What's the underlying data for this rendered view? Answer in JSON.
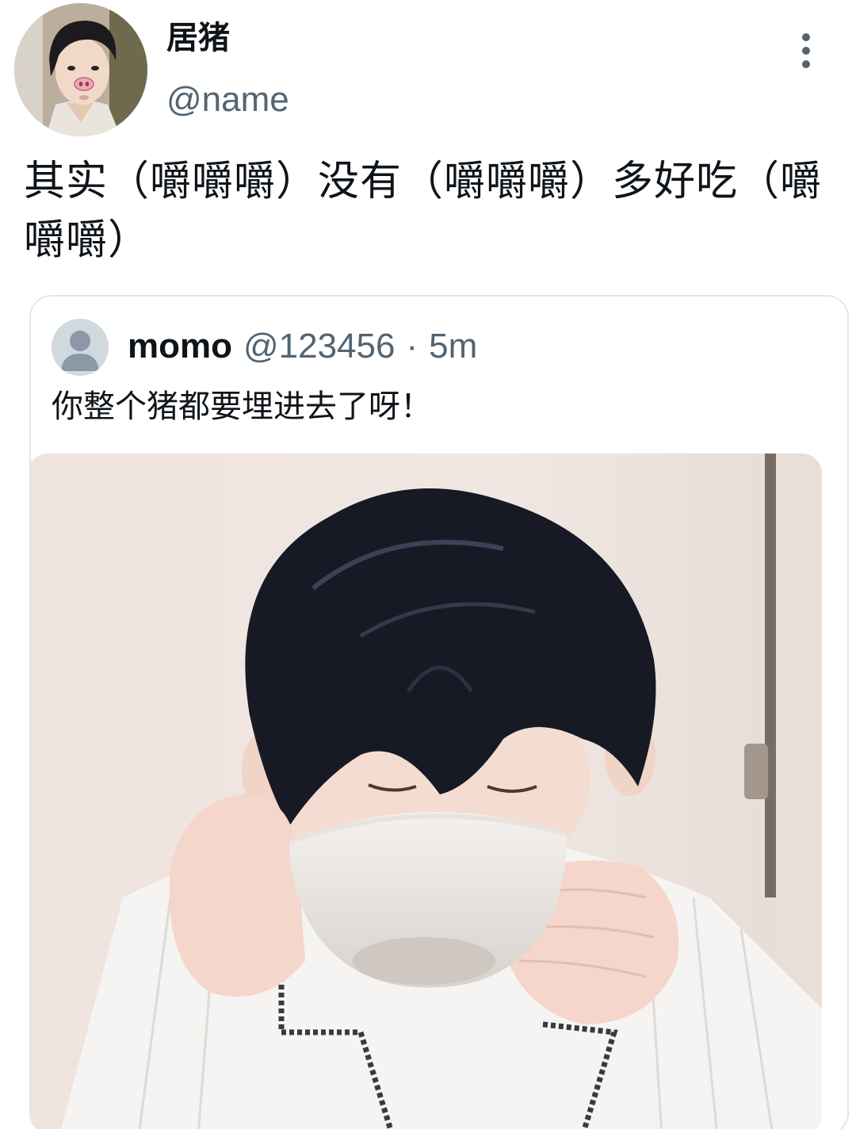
{
  "author": {
    "display_name": "居猪",
    "handle": "@name"
  },
  "tweet": {
    "text": "其实（嚼嚼嚼）没有（嚼嚼嚼）多好吃（嚼嚼嚼）"
  },
  "quoted_tweet": {
    "name": "momo",
    "handle": "@123456",
    "separator": "·",
    "time": "5m",
    "text": "你整个猪都要埋进去了呀！"
  },
  "icons": {
    "more": "more-vertical-icon",
    "default_avatar": "default-avatar-icon"
  },
  "colors": {
    "text_primary": "#0f1419",
    "text_secondary": "#536471",
    "border": "#e3e7ea",
    "avatar_placeholder": "#cfd9de"
  }
}
